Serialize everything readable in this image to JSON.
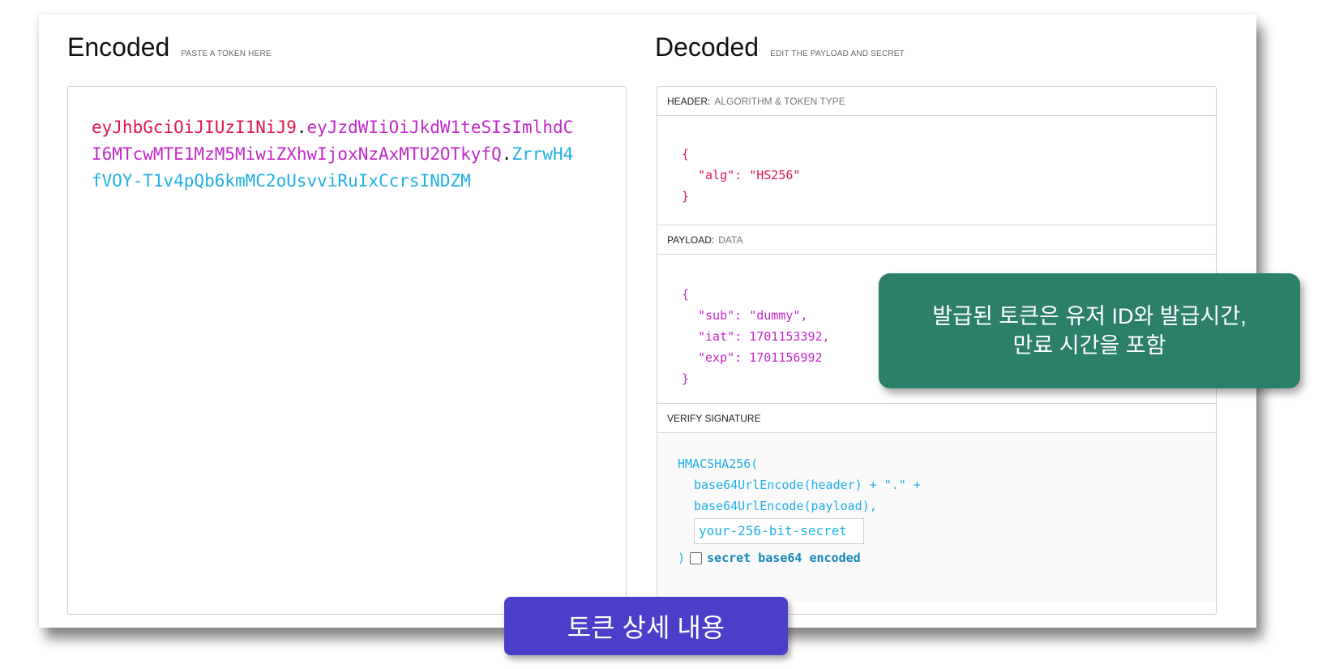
{
  "encoded": {
    "title": "Encoded",
    "subtitle": "PASTE A TOKEN HERE",
    "token_header": "eyJhbGciOiJIUzI1NiJ9",
    "token_payload": "eyJzdWIiOiJkdW1teSIsImlhdCI6MTcwMTE1MzM5MiwiZXhwIjoxNzAxMTU2OTkyfQ",
    "token_signature": "ZrrwH4fVOY-T1v4pQb6kmMC2oUsvviRuIxCcrsINDZM",
    "dot": "."
  },
  "decoded": {
    "title": "Decoded",
    "subtitle": "EDIT THE PAYLOAD AND SECRET",
    "header_panel": {
      "label": "HEADER:",
      "sublabel": "ALGORITHM & TOKEN TYPE",
      "open": "{",
      "line1": "\"alg\": \"HS256\"",
      "close": "}"
    },
    "payload_panel": {
      "label": "PAYLOAD:",
      "sublabel": "DATA",
      "open": "{",
      "line1": "\"sub\": \"dummy\",",
      "line2": "\"iat\": 1701153392,",
      "line3": "\"exp\": 1701156992",
      "close": "}"
    },
    "signature_panel": {
      "label": "VERIFY SIGNATURE",
      "line1": "HMACSHA256(",
      "line2": "base64UrlEncode(header) + \".\" +",
      "line3": "base64UrlEncode(payload),",
      "secret_value": "your-256-bit-secret",
      "close": ")",
      "checkbox_label": "secret base64 encoded",
      "checkbox_checked": false
    }
  },
  "callout": {
    "line1": "발급된 토큰은 유저 ID와 발급시간,",
    "line2": "만료 시간을 포함"
  },
  "bottom_label": "토큰 상세 내용",
  "colors": {
    "header": "#e0164a",
    "payload": "#c327c9",
    "signature": "#1fb0e6",
    "callout_bg": "#2c8069",
    "bottom_label_bg": "#4b3ec9"
  }
}
